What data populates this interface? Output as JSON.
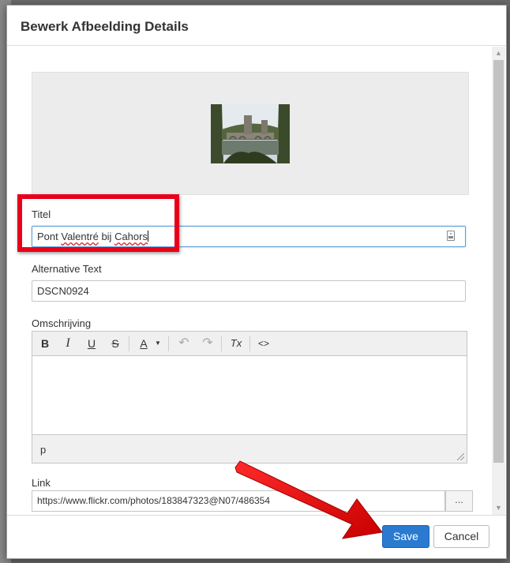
{
  "dialog": {
    "title": "Bewerk Afbeelding Details"
  },
  "fields": {
    "title_label": "Titel",
    "title_value_parts": [
      "Pont ",
      "Valentré",
      " bij ",
      "Cahors"
    ],
    "alt_label": "Alternative Text",
    "alt_value": "DSCN0924",
    "description_label": "Omschrijving",
    "link_label": "Link",
    "link_value": "https://www.flickr.com/photos/183847323@N07/486354",
    "link_button": "..."
  },
  "editor": {
    "toolbar": [
      {
        "name": "bold-icon",
        "glyph": "B"
      },
      {
        "name": "italic-icon",
        "glyph": "I"
      },
      {
        "name": "underline-icon",
        "glyph": "U"
      },
      {
        "name": "strikethrough-icon",
        "glyph": "S"
      },
      {
        "name": "text-color-icon",
        "glyph": "A"
      },
      {
        "name": "undo-icon",
        "glyph": "↶"
      },
      {
        "name": "redo-icon",
        "glyph": "↷"
      },
      {
        "name": "clear-format-icon",
        "glyph": "Tx"
      },
      {
        "name": "source-code-icon",
        "glyph": "<>"
      }
    ],
    "status_path": "p"
  },
  "footer": {
    "save_label": "Save",
    "cancel_label": "Cancel"
  },
  "colors": {
    "primary": "#2a7bd0",
    "annotation": "#e8001b"
  }
}
